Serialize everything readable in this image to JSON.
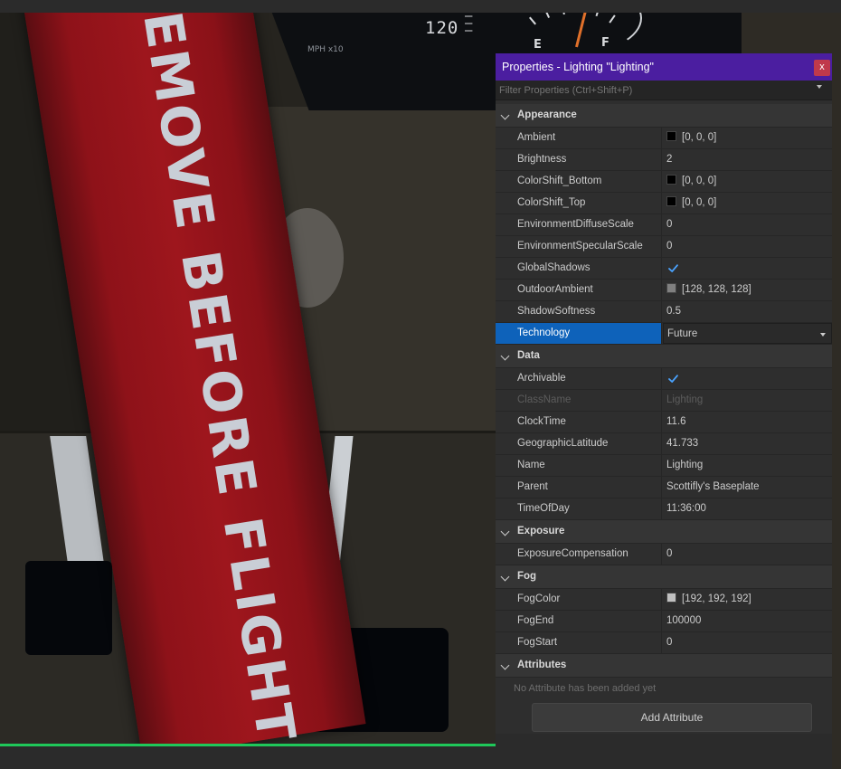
{
  "viewport": {
    "speed_label": "120",
    "speed_ticks": "—\n—\n—",
    "mph_label": "MPH x10",
    "fuel_e": "E",
    "fuel_f": "F",
    "ribbon_text": "REMOVE BEFORE FLIGHT",
    "colors": {
      "ribbon": "#9e161d",
      "ribbon_text": "#c9ced6",
      "underline": "#1fc85a"
    }
  },
  "panel": {
    "title": "Properties - Lighting \"Lighting\"",
    "close_label": "x",
    "filter_placeholder": "Filter Properties (Ctrl+Shift+P)",
    "colors": {
      "titlebar": "#4b1ea0",
      "selection": "#0e62ba",
      "close": "#c0394b",
      "check": "#4aa3ff"
    },
    "categories": [
      {
        "label": "Appearance",
        "rows": [
          {
            "name": "Ambient",
            "type": "color",
            "value": "[0, 0, 0]",
            "swatch": "#000000"
          },
          {
            "name": "Brightness",
            "type": "text",
            "value": "2"
          },
          {
            "name": "ColorShift_Bottom",
            "type": "color",
            "value": "[0, 0, 0]",
            "swatch": "#000000"
          },
          {
            "name": "ColorShift_Top",
            "type": "color",
            "value": "[0, 0, 0]",
            "swatch": "#000000"
          },
          {
            "name": "EnvironmentDiffuseScale",
            "type": "text",
            "value": "0"
          },
          {
            "name": "EnvironmentSpecularScale",
            "type": "text",
            "value": "0"
          },
          {
            "name": "GlobalShadows",
            "type": "bool",
            "value": true
          },
          {
            "name": "OutdoorAmbient",
            "type": "color",
            "value": "[128, 128, 128]",
            "swatch": "#808080"
          },
          {
            "name": "ShadowSoftness",
            "type": "text",
            "value": "0.5"
          },
          {
            "name": "Technology",
            "type": "enum",
            "value": "Future",
            "selected": true
          }
        ]
      },
      {
        "label": "Data",
        "rows": [
          {
            "name": "Archivable",
            "type": "bool",
            "value": true
          },
          {
            "name": "ClassName",
            "type": "text",
            "value": "Lighting",
            "disabled": true
          },
          {
            "name": "ClockTime",
            "type": "text",
            "value": "11.6"
          },
          {
            "name": "GeographicLatitude",
            "type": "text",
            "value": "41.733"
          },
          {
            "name": "Name",
            "type": "text",
            "value": "Lighting"
          },
          {
            "name": "Parent",
            "type": "text",
            "value": "Scottifly's Baseplate"
          },
          {
            "name": "TimeOfDay",
            "type": "text",
            "value": "11:36:00"
          }
        ]
      },
      {
        "label": "Exposure",
        "rows": [
          {
            "name": "ExposureCompensation",
            "type": "text",
            "value": "0"
          }
        ]
      },
      {
        "label": "Fog",
        "rows": [
          {
            "name": "FogColor",
            "type": "color",
            "value": "[192, 192, 192]",
            "swatch": "#c0c0c0"
          },
          {
            "name": "FogEnd",
            "type": "text",
            "value": "100000"
          },
          {
            "name": "FogStart",
            "type": "text",
            "value": "0"
          }
        ]
      },
      {
        "label": "Attributes",
        "empty_note": "No Attribute has been added yet",
        "button_label": "Add Attribute",
        "rows": []
      }
    ]
  }
}
